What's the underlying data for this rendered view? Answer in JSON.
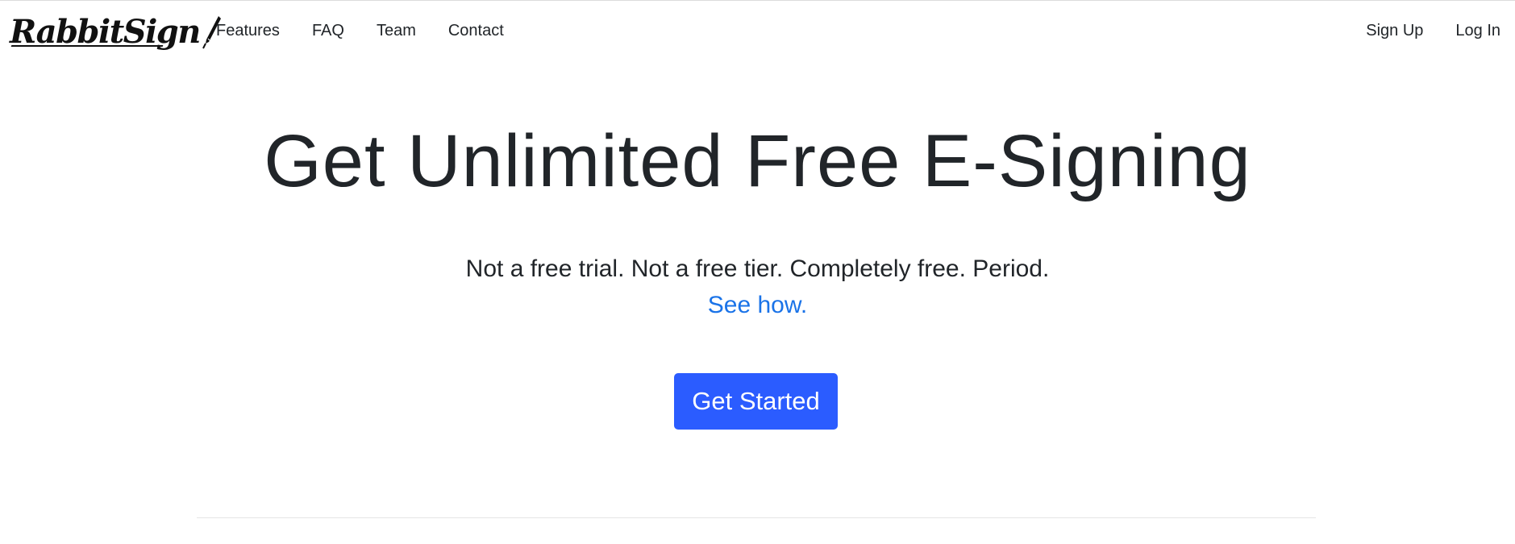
{
  "brand": {
    "name": "RabbitSign"
  },
  "nav": {
    "left": [
      {
        "label": "Features"
      },
      {
        "label": "FAQ"
      },
      {
        "label": "Team"
      },
      {
        "label": "Contact"
      }
    ],
    "right": [
      {
        "label": "Sign Up"
      },
      {
        "label": "Log In"
      }
    ]
  },
  "hero": {
    "title": "Get Unlimited Free E-Signing",
    "subtitle": "Not a free trial. Not a free tier. Completely free. Period.",
    "link_label": "See how.",
    "cta_label": "Get Started"
  },
  "colors": {
    "primary_button": "#2b5cff",
    "link": "#1a73e8",
    "text": "#212529"
  },
  "icons": {
    "brand_pen": "pen-nib-icon"
  }
}
